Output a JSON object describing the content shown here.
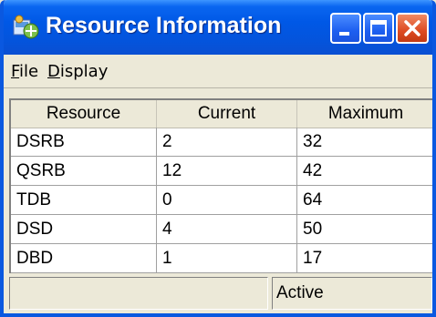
{
  "window": {
    "title": "Resource Information",
    "app_icon": "resource-app-icon",
    "controls": [
      "minimize-icon",
      "maximize-icon",
      "close-icon"
    ]
  },
  "menu": {
    "file_underlined": "F",
    "file_rest": "ile",
    "display_underlined": "D",
    "display_rest": "isplay"
  },
  "table": {
    "columns": [
      "Resource",
      "Current",
      "Maximum"
    ],
    "rows": [
      {
        "resource": "DSRB",
        "current": "2",
        "maximum": "32"
      },
      {
        "resource": "QSRB",
        "current": "12",
        "maximum": "42"
      },
      {
        "resource": "TDB",
        "current": "0",
        "maximum": "64"
      },
      {
        "resource": "DSD",
        "current": "4",
        "maximum": "50"
      },
      {
        "resource": "DBD",
        "current": "1",
        "maximum": "17"
      }
    ]
  },
  "status": {
    "left_text": "",
    "right_text": "Active"
  },
  "colors": {
    "titlebar": "#0058e6",
    "close_button": "#de4b22",
    "window_bg": "#ece9d8"
  }
}
